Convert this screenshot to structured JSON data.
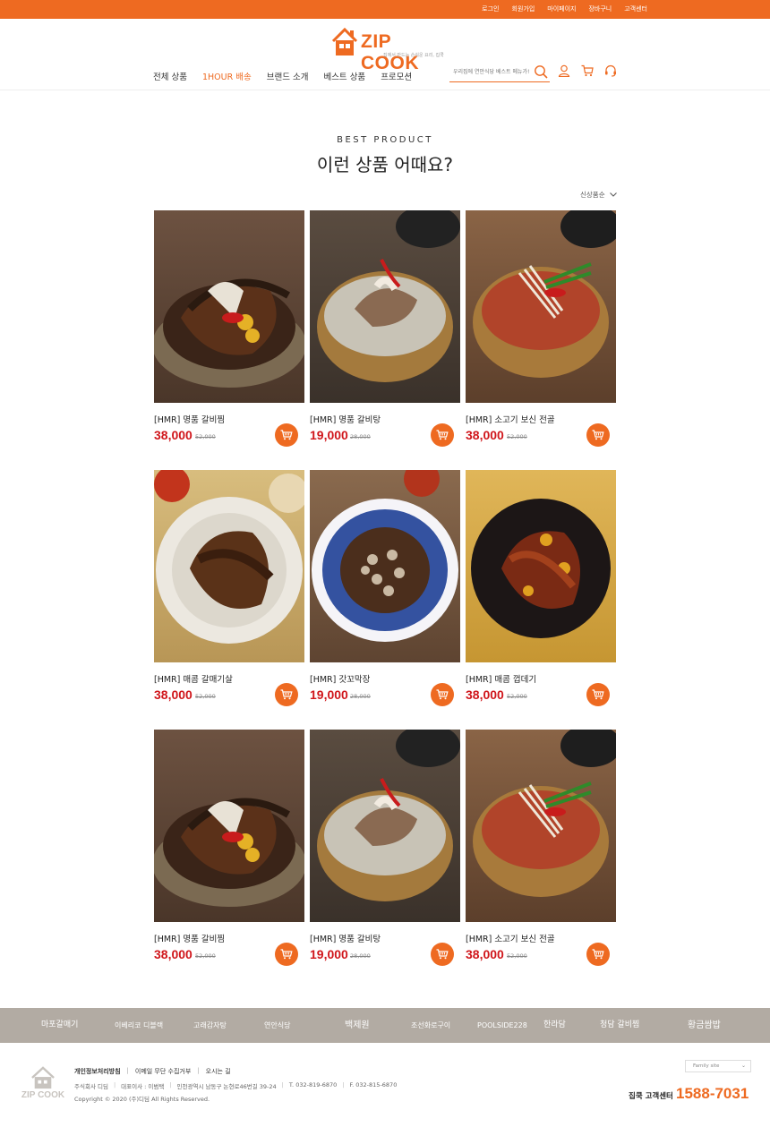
{
  "colors": {
    "accent": "#ee6a21",
    "price": "#d0161b",
    "brand_strip": "#b2aba3"
  },
  "topbar": {
    "links": [
      "로그인",
      "회원가입",
      "마이페이지",
      "장바구니",
      "고객센터"
    ]
  },
  "logo": {
    "text": "ZIP COOK",
    "tagline": "집에서 만드는 손쉬운 요리, 집쿡"
  },
  "nav": {
    "items": [
      "전체 상품",
      "1HOUR 배송",
      "브랜드 소개",
      "베스트 상품",
      "프로모션"
    ],
    "active_index": 1
  },
  "search": {
    "placeholder": "우리집에 연안식당 베스트 메뉴가!"
  },
  "utility_icons": [
    "user-icon",
    "cart-icon",
    "headset-icon"
  ],
  "section": {
    "subtitle": "BEST PRODUCT",
    "title": "이런 상품 어때요?",
    "sort_label": "신상품순"
  },
  "products": [
    {
      "name": "[HMR] 명품 갈비찜",
      "price": "38,000",
      "original": "52,000",
      "dish": "galbijjim"
    },
    {
      "name": "[HMR] 명품 갈비탕",
      "price": "19,000",
      "original": "28,000",
      "dish": "galbitang"
    },
    {
      "name": "[HMR] 소고기 보신 전골",
      "price": "38,000",
      "original": "52,000",
      "dish": "jeongol"
    },
    {
      "name": "[HMR] 매콤 갈매기살",
      "price": "38,000",
      "original": "52,000",
      "dish": "galmaegi"
    },
    {
      "name": "[HMR] 갓꼬막장",
      "price": "19,000",
      "original": "28,000",
      "dish": "kkomak"
    },
    {
      "name": "[HMR] 매콤 껍데기",
      "price": "38,000",
      "original": "52,000",
      "dish": "kkeopdegi"
    },
    {
      "name": "[HMR] 명품 갈비찜",
      "price": "38,000",
      "original": "52,000",
      "dish": "galbijjim"
    },
    {
      "name": "[HMR] 명품 갈비탕",
      "price": "19,000",
      "original": "28,000",
      "dish": "galbitang"
    },
    {
      "name": "[HMR] 소고기 보신 전골",
      "price": "38,000",
      "original": "52,000",
      "dish": "jeongol"
    }
  ],
  "brands": [
    "마포갈매기",
    "이베리코 디블랙",
    "고래감자탕",
    "연안식당",
    "백제원",
    "조선화로구이",
    "POOLSIDE228",
    "한라담",
    "청담 갈비찜",
    "황금쌈밥"
  ],
  "footer": {
    "links": [
      "개인정보처리방침",
      "이메일 무단 수집거부",
      "오시는 길"
    ],
    "info": [
      "주식회사 디딤",
      "대표이사 : 이범택",
      "인천광역시 남동구 논현로46번길 39-24",
      "T. 032-819-6870",
      "F. 032-815-6870"
    ],
    "copyright": "Copyright © 2020 (주)디딤  All Rights Reserved.",
    "family_site": "Family site",
    "cs_label": "집쿡 고객센터",
    "cs_number": "1588-7031",
    "logo_text": "ZIP COOK"
  }
}
